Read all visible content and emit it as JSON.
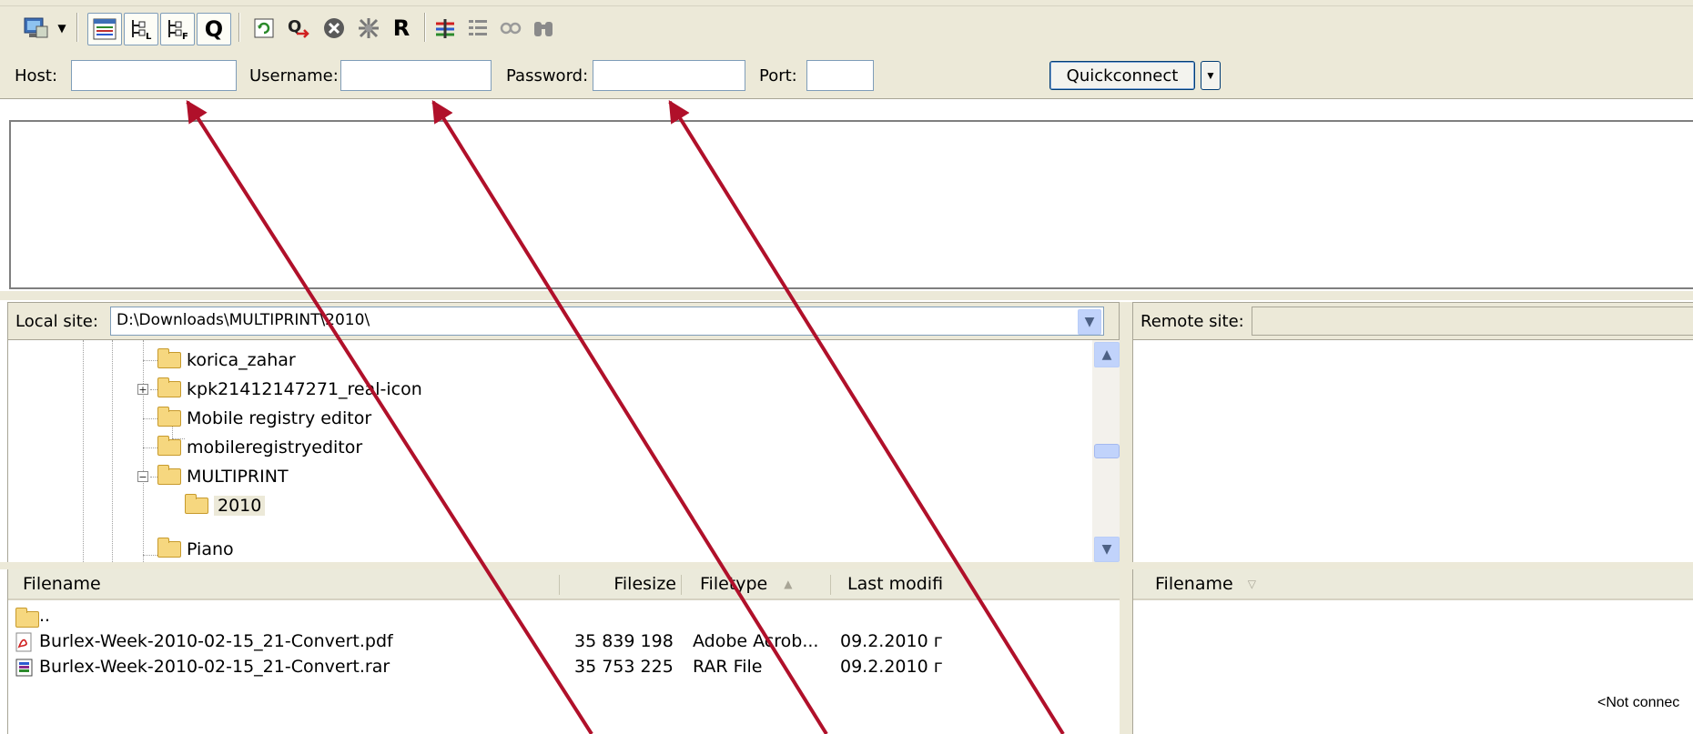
{
  "quickconnect": {
    "host_label": "Host:",
    "host_value": "",
    "username_label": "Username:",
    "username_value": "",
    "password_label": "Password:",
    "password_value": "",
    "port_label": "Port:",
    "port_value": "",
    "connect_label": "Quickconnect"
  },
  "toolbar": {
    "reconnect_letter": "R",
    "queue_letter": "Q"
  },
  "local_site": {
    "label": "Local site:",
    "path": "D:\\Downloads\\MULTIPRINT\\2010\\",
    "tree": [
      {
        "label": "korica_zahar"
      },
      {
        "label": "kpk21412147271_real-icon"
      },
      {
        "label": "Mobile registry editor"
      },
      {
        "label": "mobileregistryeditor"
      },
      {
        "label": "MULTIPRINT"
      },
      {
        "label": "2010"
      },
      {
        "label": "Piano"
      }
    ],
    "columns": {
      "filename": "Filename",
      "filesize": "Filesize",
      "filetype": "Filetype",
      "last_modified": "Last modifi"
    },
    "files": [
      {
        "name": "..",
        "size": "",
        "type": "",
        "modified": ""
      },
      {
        "name": "Burlex-Week-2010-02-15_21-Convert.pdf",
        "size": "35 839 198",
        "type": "Adobe Acrob...",
        "modified": "09.2.2010 г"
      },
      {
        "name": "Burlex-Week-2010-02-15_21-Convert.rar",
        "size": "35 753 225",
        "type": "RAR File",
        "modified": "09.2.2010 г"
      }
    ]
  },
  "remote_site": {
    "label": "Remote site:",
    "column_filename": "Filename",
    "status": "<Not connec"
  },
  "colors": {
    "chrome": "#ece9d8",
    "input_border": "#7f9db9",
    "arrow": "#b0102a",
    "folder": "#f6d77f"
  },
  "icons": [
    "site-manager-icon",
    "message-log-icon",
    "local-tree-icon",
    "remote-tree-icon",
    "queue-icon",
    "refresh-icon",
    "process-queue-icon",
    "cancel-icon",
    "disconnect-icon",
    "reconnect-icon",
    "compare-icon",
    "filter-icon",
    "sync-browse-icon",
    "search-icon"
  ]
}
